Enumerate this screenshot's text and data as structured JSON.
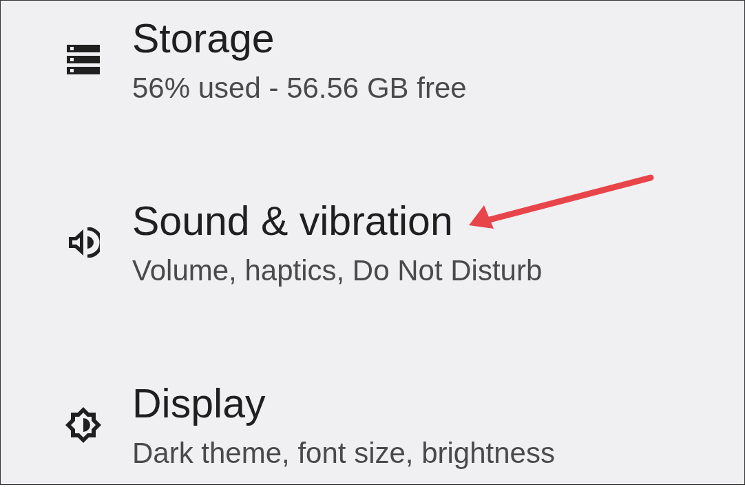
{
  "settings_items": [
    {
      "kind": "storage",
      "title": "Storage",
      "summary": "56% used - 56.56 GB free",
      "pointed_at": false
    },
    {
      "kind": "sound",
      "title": "Sound & vibration",
      "summary": "Volume, haptics, Do Not Disturb",
      "pointed_at": true
    },
    {
      "kind": "display",
      "title": "Display",
      "summary": "Dark theme, font size, brightness",
      "pointed_at": false
    }
  ]
}
